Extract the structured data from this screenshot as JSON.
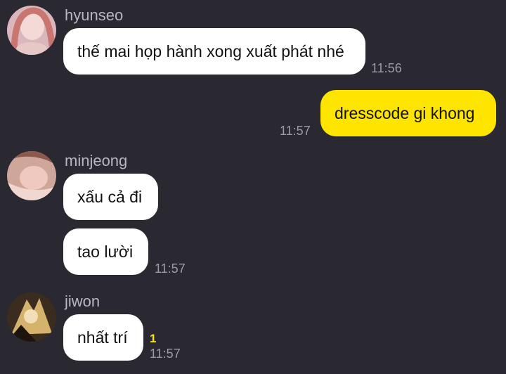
{
  "messages": [
    {
      "sender": "hyunseo",
      "text": "thế mai họp hành xong xuất phát nhé",
      "time": "11:56"
    },
    {
      "text": "dresscode gi khong",
      "time": "11:57"
    },
    {
      "sender": "minjeong",
      "texts": [
        "xấu cả đi",
        "tao lười"
      ],
      "time": "11:57"
    },
    {
      "sender": "jiwon",
      "text": "nhất trí",
      "unread": "1",
      "time": "11:57"
    }
  ],
  "colors": {
    "background": "#2a2830",
    "incoming_bubble": "#ffffff",
    "outgoing_bubble": "#fee500",
    "unread_count": "#fee500",
    "timestamp": "#9e9ba6",
    "sender_name": "#b9b6c0"
  }
}
